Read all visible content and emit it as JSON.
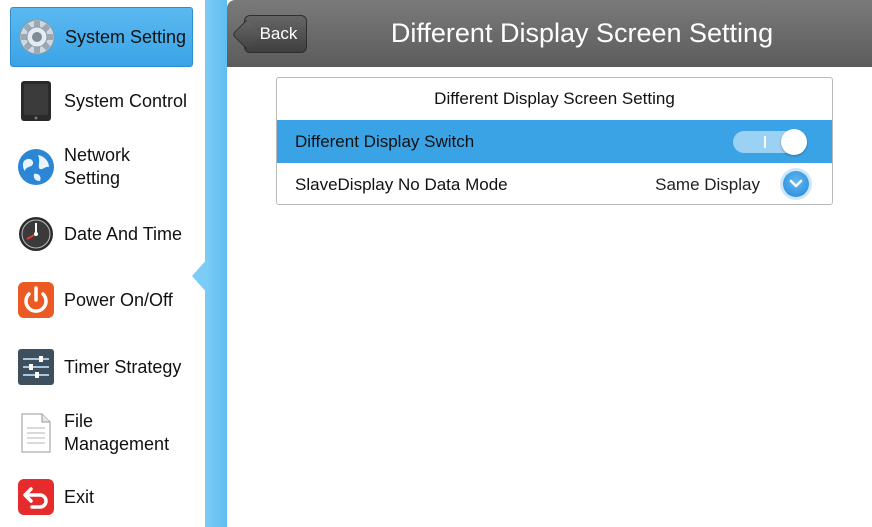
{
  "sidebar": {
    "items": [
      {
        "label": "System Setting",
        "icon": "gear-icon",
        "active": true
      },
      {
        "label": "System Control",
        "icon": "tablet-icon",
        "active": false
      },
      {
        "label": "Network Setting",
        "label_line1": "Network",
        "label_line2": "Setting",
        "icon": "globe-icon",
        "active": false
      },
      {
        "label": "Date And Time",
        "icon": "clock-icon",
        "active": false
      },
      {
        "label": "Power On/Off",
        "icon": "power-icon",
        "active": false
      },
      {
        "label": "Timer Strategy",
        "icon": "sliders-icon",
        "active": false
      },
      {
        "label": "File Management",
        "label_line1": "File",
        "label_line2": "Management",
        "icon": "document-icon",
        "active": false
      },
      {
        "label": "Exit",
        "icon": "exit-icon",
        "active": false
      }
    ]
  },
  "header": {
    "back_label": "Back",
    "title": "Different Display Screen Setting"
  },
  "panel": {
    "title": "Different Display Screen Setting",
    "rows": [
      {
        "label": "Different Display Switch",
        "control": "toggle",
        "value": true,
        "selected": true
      },
      {
        "label": "SlaveDisplay No Data Mode",
        "control": "dropdown",
        "value": "Same Display",
        "selected": false
      }
    ]
  },
  "colors": {
    "accent": "#3aa3e6",
    "header": "#666666",
    "strip": "#7ccdf5"
  }
}
